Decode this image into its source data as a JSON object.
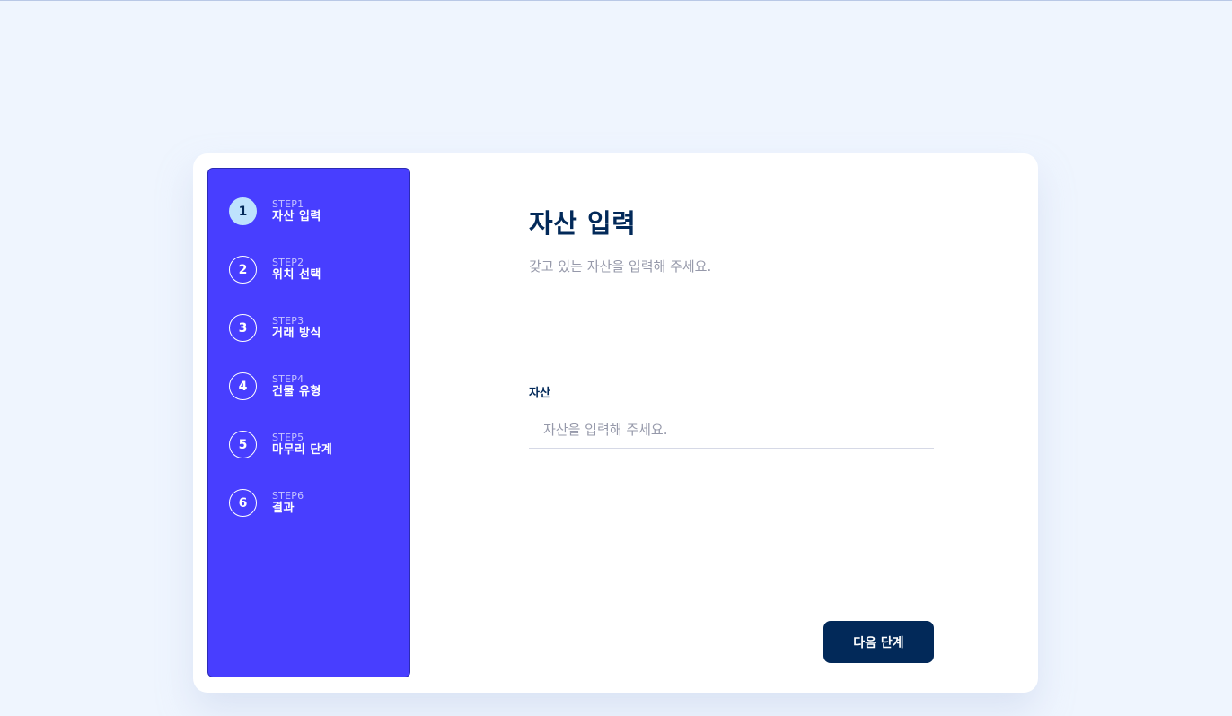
{
  "sidebar": {
    "steps": [
      {
        "number": "1",
        "label": "STEP1",
        "title": "자산 입력",
        "active": true
      },
      {
        "number": "2",
        "label": "STEP2",
        "title": "위치 선택",
        "active": false
      },
      {
        "number": "3",
        "label": "STEP3",
        "title": "거래 방식",
        "active": false
      },
      {
        "number": "4",
        "label": "STEP4",
        "title": "건물 유형",
        "active": false
      },
      {
        "number": "5",
        "label": "STEP5",
        "title": "마무리 단계",
        "active": false
      },
      {
        "number": "6",
        "label": "STEP6",
        "title": "결과",
        "active": false
      }
    ]
  },
  "main": {
    "title": "자산 입력",
    "subtitle": "갖고 있는 자산을 입력해 주세요.",
    "asset_field": {
      "label": "자산",
      "value": "",
      "placeholder": "자산을 입력해 주세요."
    },
    "next_button": "다음 단계"
  },
  "colors": {
    "background": "#eff5fe",
    "sidebar": "#483eff",
    "active_step": "#bee2fd",
    "primary": "#022959",
    "muted_text": "#9699aa"
  }
}
